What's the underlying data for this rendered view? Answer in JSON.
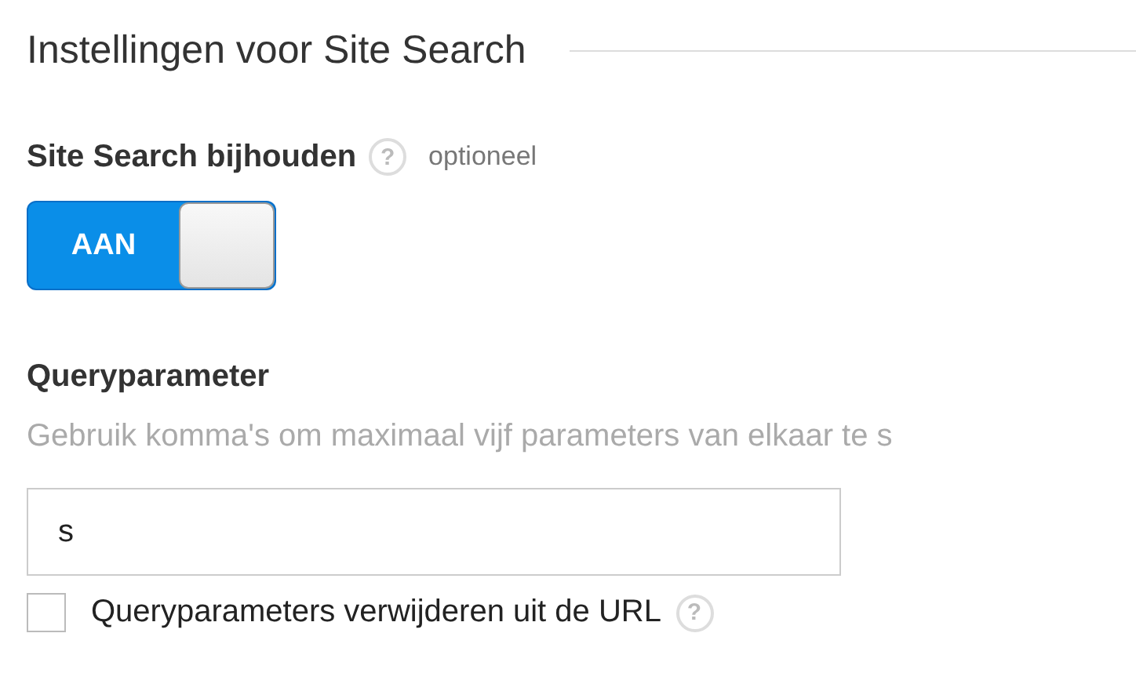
{
  "section": {
    "title": "Instellingen voor Site Search"
  },
  "tracking": {
    "label": "Site Search bijhouden",
    "help": "?",
    "note": "optioneel",
    "toggle": {
      "on": true,
      "label": "AAN"
    }
  },
  "query_parameter": {
    "label": "Queryparameter",
    "hint": "Gebruik komma's om maximaal vijf parameters van elkaar te s",
    "value": "s"
  },
  "strip_option": {
    "label": "Queryparameters verwijderen uit de URL",
    "checked": false,
    "help": "?"
  }
}
